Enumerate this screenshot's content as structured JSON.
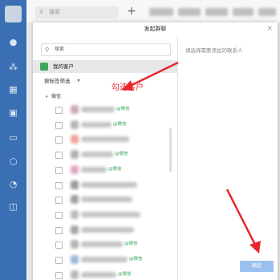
{
  "app": {
    "search_placeholder": "搜索",
    "plus": "+"
  },
  "dialog": {
    "title": "发起群聊",
    "close": "×",
    "search_placeholder": "搜索",
    "customers_label": "我的客户",
    "filter_label": "按标签筛选",
    "group_label": "微信",
    "right_hint": "请选择需要添加的联系人",
    "ok_button": "确定",
    "wechat_tag": "@微信"
  },
  "annotation": {
    "text": "勾选客户",
    "color": "#e8272f"
  },
  "colors": {
    "rail": "#3b6fb4",
    "accent_green": "#3ca65c",
    "button_disabled": "#9dc1ee"
  },
  "rail_icons": [
    "chat-icon",
    "org-icon",
    "calendar-icon",
    "workbench-icon",
    "doc-icon",
    "cube-icon",
    "drive-icon",
    "more-icon"
  ],
  "contacts": [
    {
      "checked": false,
      "tag": "@微信",
      "blur_color": "#c9a7b8"
    },
    {
      "checked": false,
      "tag": "@微信",
      "blur_color": "#b6b6b6"
    },
    {
      "checked": false,
      "tag": "",
      "blur_color": "#f0a59a"
    },
    {
      "checked": false,
      "tag": "@微信",
      "blur_color": "#b0b0b0"
    },
    {
      "checked": false,
      "tag": "@微信",
      "blur_color": "#e2a7c4"
    },
    {
      "checked": false,
      "tag": "",
      "blur_color": "#9a9a9a"
    },
    {
      "checked": false,
      "tag": "",
      "blur_color": "#a0a0a0"
    },
    {
      "checked": false,
      "tag": "",
      "blur_color": "#bdbdbd"
    },
    {
      "checked": false,
      "tag": "",
      "blur_color": "#a6a6a6"
    },
    {
      "checked": false,
      "tag": "@微信",
      "blur_color": "#b4b4b4"
    },
    {
      "checked": false,
      "tag": "@微信",
      "blur_color": "#9cb7d6"
    },
    {
      "checked": false,
      "tag": "@微信",
      "blur_color": "#b8b8b8"
    }
  ]
}
